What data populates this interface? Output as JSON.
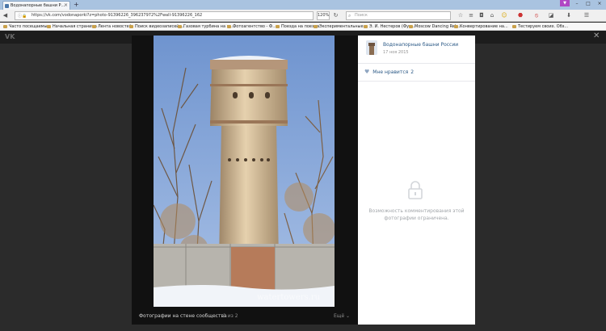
{
  "browser": {
    "tab_title": "Водонапорные башни Р...",
    "url": "https://vk.com/vodonaporki?z=photo-91396226_396237972%2Fwall-91396226_162",
    "zoom": "120%",
    "search_placeholder": "Поиск",
    "bookmarks": [
      "Часто посещаемые",
      "Начальная страница",
      "Лента новостей",
      "Поиск видеозаписей ...",
      "Газовая турбина на ж...",
      "Фотоагентство - Ф...",
      "Поезда на поезда",
      "Экспериментальные...",
      "Э. И. Нестеров (Фут...",
      "Moscow Dancing Reb...",
      "Конвертирование на...",
      "Тестируем своих. Обз..."
    ]
  },
  "vk": {
    "logo": "VK",
    "close": "✕"
  },
  "viewer": {
    "caption": "Фотографии на стене сообщества",
    "counter": "1 из 2",
    "more": "Ещё ⌄",
    "watermark": "watertowers.ru"
  },
  "panel": {
    "community_name": "Водонапорные башни России",
    "post_date": "17 ноя 2015",
    "like_label": "Мне нравится",
    "like_count": "2",
    "comments_disabled": "Возможность комментирования этой фотографии ограничена."
  },
  "colors": {
    "vk_link": "#2a5885",
    "overlay": "#2b2b2b",
    "panel_bg": "#ffffff"
  }
}
